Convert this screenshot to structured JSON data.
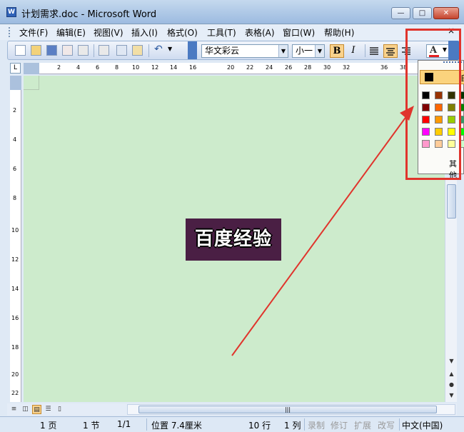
{
  "window": {
    "title": "计划需求.doc - Microsoft Word",
    "app_icon": "W",
    "buttons": {
      "minimize": "—",
      "maximize": "□",
      "close": "✕"
    }
  },
  "menubar": {
    "items": [
      "文件(F)",
      "编辑(E)",
      "视图(V)",
      "插入(I)",
      "格式(O)",
      "工具(T)",
      "表格(A)",
      "窗口(W)",
      "帮助(H)"
    ],
    "close_glyph": "×"
  },
  "toolbar": {
    "font_name": "华文彩云",
    "font_size": "小一",
    "bold_label": "B",
    "italic_label": "I",
    "font_color_letter": "A",
    "font_color_swatch": "#e52222",
    "dropdown_arrow": "▼",
    "undo_glyph": "↶"
  },
  "ruler": {
    "corner": "L",
    "h_ticks": [
      "2",
      "4",
      "6",
      "8",
      "10",
      "12",
      "14",
      "16",
      "20",
      "22",
      "24",
      "26",
      "28",
      "30",
      "32",
      "36",
      "38"
    ],
    "v_ticks": [
      "2",
      "4",
      "6",
      "8",
      "10",
      "12",
      "14",
      "16",
      "18",
      "20",
      "22"
    ]
  },
  "document": {
    "content_text": "百度经验",
    "highlight_color": "#4a1f44",
    "page_color": "#cdebcc"
  },
  "color_popup": {
    "auto_label": "自",
    "more_label": "其他",
    "swatches": [
      [
        "#000000",
        "#993300",
        "#333300",
        "#003300"
      ],
      [
        "#800000",
        "#ff6600",
        "#808000",
        "#008000"
      ],
      [
        "#ff0000",
        "#ff9900",
        "#99cc00",
        "#339966"
      ],
      [
        "#ff00ff",
        "#ffcc00",
        "#ffff00",
        "#00ff00"
      ],
      [
        "#ff99cc",
        "#ffcc99",
        "#ffff99",
        "#ccffcc"
      ]
    ]
  },
  "statusbar": {
    "page": "1 页",
    "section": "1 节",
    "page_of": "1/1",
    "position": "位置 7.4厘米",
    "line": "10 行",
    "column": "1 列",
    "rec": "录制",
    "trk": "修订",
    "ext": "扩展",
    "ovr": "改写",
    "language": "中文(中国)"
  },
  "annotation": {
    "color": "#e0342c"
  }
}
